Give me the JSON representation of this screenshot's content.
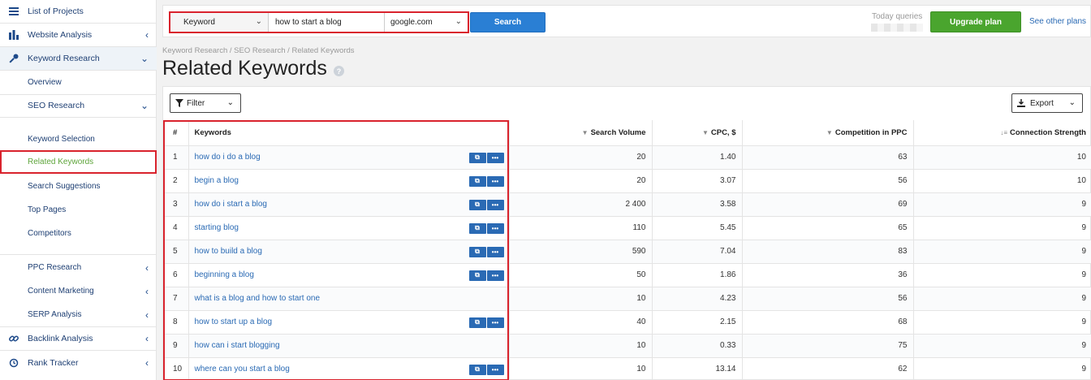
{
  "sidebar": {
    "list_of_projects": "List of Projects",
    "website_analysis": "Website Analysis",
    "keyword_research": "Keyword Research",
    "overview": "Overview",
    "seo_research": "SEO Research",
    "keyword_selection": "Keyword Selection",
    "related_keywords": "Related Keywords",
    "search_suggestions": "Search Suggestions",
    "top_pages": "Top Pages",
    "competitors": "Competitors",
    "ppc_research": "PPC Research",
    "content_marketing": "Content Marketing",
    "serp_analysis": "SERP Analysis",
    "backlink_analysis": "Backlink Analysis",
    "rank_tracker": "Rank Tracker"
  },
  "search": {
    "type": "Keyword",
    "query": "how to start a blog",
    "engine": "google.com",
    "button": "Search"
  },
  "header": {
    "today_queries": "Today queries",
    "upgrade": "Upgrade plan",
    "see_plans": "See other plans"
  },
  "breadcrumb": "Keyword Research / SEO Research / Related Keywords",
  "page_title": "Related Keywords",
  "toolbar": {
    "filter": "Filter",
    "export": "Export"
  },
  "table": {
    "columns": [
      "#",
      "Keywords",
      "Search Volume",
      "CPC, $",
      "Competition in PPC",
      "Connection Strength"
    ],
    "rows": [
      {
        "n": "1",
        "kw": "how do i do a blog",
        "vol": "20",
        "cpc": "1.40",
        "comp": "63",
        "conn": "10",
        "actions": true
      },
      {
        "n": "2",
        "kw": "begin a blog",
        "vol": "20",
        "cpc": "3.07",
        "comp": "56",
        "conn": "10",
        "actions": true
      },
      {
        "n": "3",
        "kw": "how do i start a blog",
        "vol": "2 400",
        "cpc": "3.58",
        "comp": "69",
        "conn": "9",
        "actions": true
      },
      {
        "n": "4",
        "kw": "starting blog",
        "vol": "110",
        "cpc": "5.45",
        "comp": "65",
        "conn": "9",
        "actions": true
      },
      {
        "n": "5",
        "kw": "how to build a blog",
        "vol": "590",
        "cpc": "7.04",
        "comp": "83",
        "conn": "9",
        "actions": true
      },
      {
        "n": "6",
        "kw": "beginning a blog",
        "vol": "50",
        "cpc": "1.86",
        "comp": "36",
        "conn": "9",
        "actions": true
      },
      {
        "n": "7",
        "kw": "what is a blog and how to start one",
        "vol": "10",
        "cpc": "4.23",
        "comp": "56",
        "conn": "9",
        "actions": false
      },
      {
        "n": "8",
        "kw": "how to start up a blog",
        "vol": "40",
        "cpc": "2.15",
        "comp": "68",
        "conn": "9",
        "actions": true
      },
      {
        "n": "9",
        "kw": "how can i start blogging",
        "vol": "10",
        "cpc": "0.33",
        "comp": "75",
        "conn": "9",
        "actions": false
      },
      {
        "n": "10",
        "kw": "where can you start a blog",
        "vol": "10",
        "cpc": "13.14",
        "comp": "62",
        "conn": "9",
        "actions": true
      }
    ]
  },
  "colors": {
    "accent": "#2a6ab4",
    "highlight": "#d9232d",
    "upgrade": "#4aa52e",
    "active_link": "#5ea53b"
  }
}
